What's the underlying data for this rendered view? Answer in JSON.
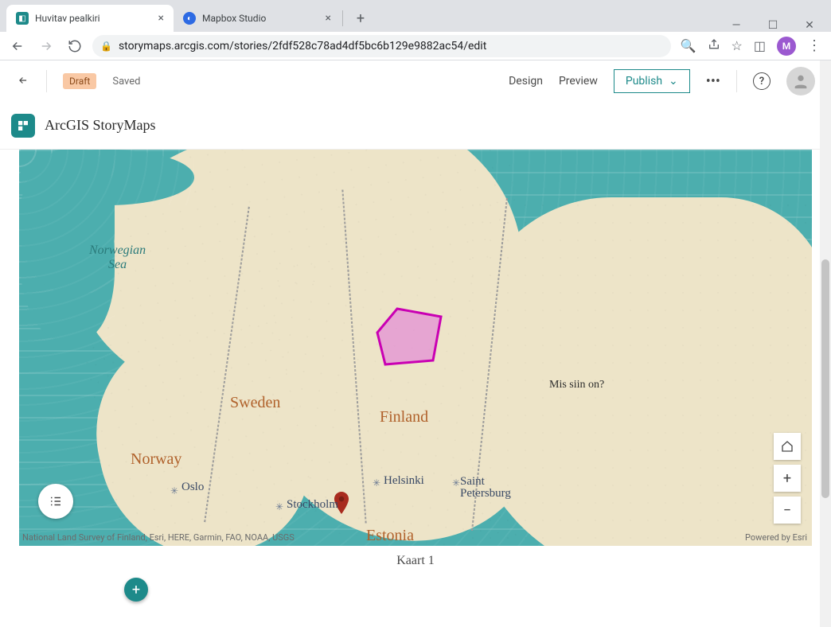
{
  "browser": {
    "tabs": [
      {
        "title": "Huvitav pealkiri",
        "active": true
      },
      {
        "title": "Mapbox Studio",
        "active": false
      }
    ],
    "url": "storymaps.arcgis.com/stories/2fdf528c78ad4df5bc6b129e9882ac54/edit",
    "avatar_initial": "M"
  },
  "header": {
    "status_badge": "Draft",
    "saved_label": "Saved",
    "design_label": "Design",
    "preview_label": "Preview",
    "publish_label": "Publish"
  },
  "brand": {
    "name": "ArcGIS StoryMaps"
  },
  "map": {
    "sea_label": "Norwegian\nSea",
    "countries": {
      "norway": "Norway",
      "sweden": "Sweden",
      "finland": "Finland",
      "estonia": "Estonia"
    },
    "cities": {
      "oslo": "Oslo",
      "stockholm": "Stockholm",
      "helsinki": "Helsinki",
      "stpetersburg": "Saint\nPetersburg"
    },
    "annotation": "Mis siin on?",
    "attribution": "National Land Survey of Finland, Esri, HERE, Garmin, FAO, NOAA, USGS",
    "powered": "Powered by Esri",
    "caption": "Kaart 1"
  }
}
